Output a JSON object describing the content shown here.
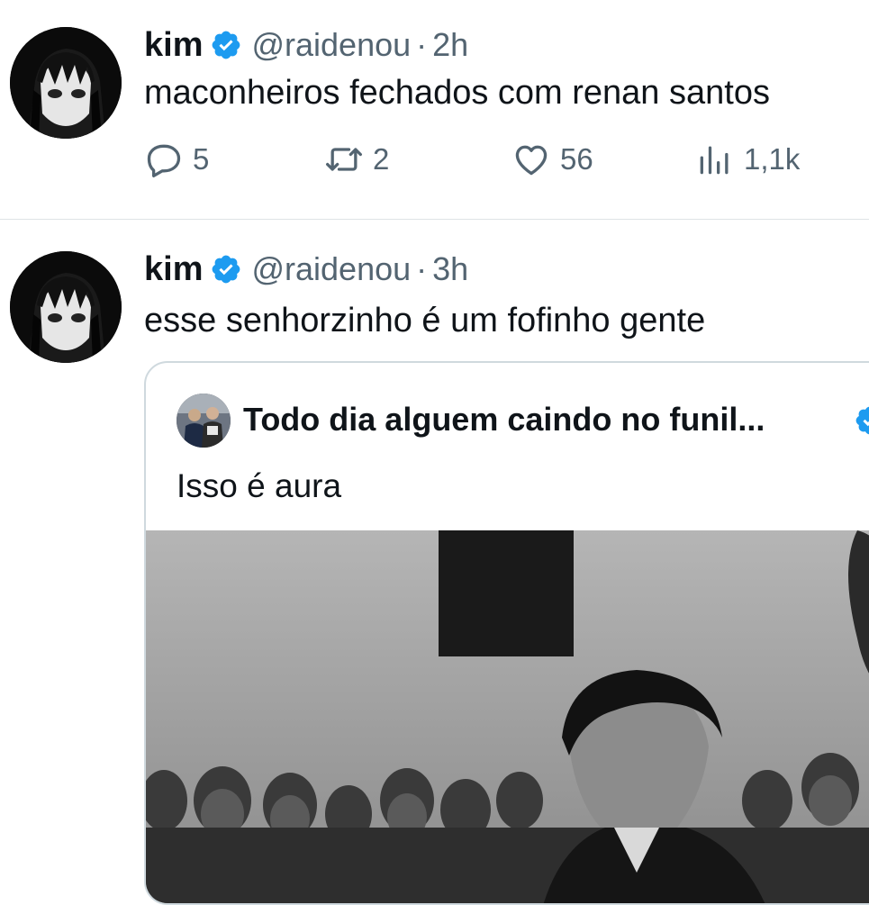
{
  "tweets": [
    {
      "author": {
        "name": "kim",
        "handle": "@raidenou",
        "verified": true
      },
      "time": "2h",
      "text": "maconheiros fechados com renan santos",
      "stats": {
        "replies": "5",
        "retweets": "2",
        "likes": "56",
        "views": "1,1k"
      }
    },
    {
      "author": {
        "name": "kim",
        "handle": "@raidenou",
        "verified": true
      },
      "time": "3h",
      "text": "esse senhorzinho é um fofinho gente",
      "quote": {
        "author_name": "Todo dia alguem caindo no funil...",
        "text": "Isso é aura"
      }
    }
  ],
  "icons": {
    "reply": "reply-icon",
    "retweet": "retweet-icon",
    "like": "heart-icon",
    "views": "views-icon",
    "verified": "verified-badge-icon"
  },
  "colors": {
    "verified": "#1d9bf0",
    "secondary_text": "#536471",
    "border": "#cfd9de"
  }
}
